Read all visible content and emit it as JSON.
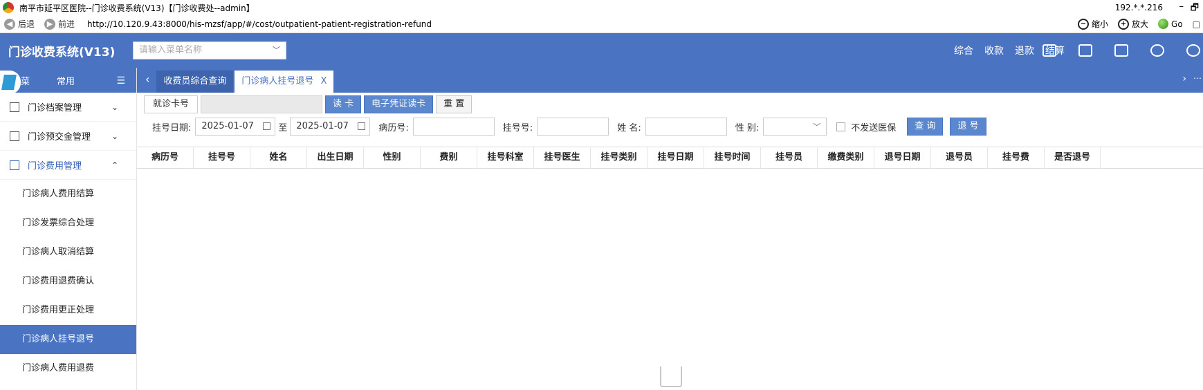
{
  "window": {
    "title": "南平市延平区医院--门诊收费系统(V13)【门诊收费处--admin】",
    "ip": "192.*.*.216",
    "minimize": "–",
    "restore": "🗗"
  },
  "browser": {
    "back": "后退",
    "forward": "前进",
    "url": "http://10.120.9.43:8000/his-mzsf/app/#/cost/outpatient-patient-registration-refund",
    "zoom_out": "缩小",
    "zoom_in": "放大",
    "go": "Go",
    "extra": "□"
  },
  "header": {
    "app_title": "门诊收费系统(V13)",
    "menu_search_placeholder": "请输入菜单名称",
    "links": [
      "综合",
      "收款",
      "退款",
      "结算"
    ]
  },
  "sidebar": {
    "top_partial": "菜",
    "favorites": "常用",
    "groups": [
      {
        "label": "门诊档案管理",
        "arrow": "⌄"
      },
      {
        "label": "门诊预交金管理",
        "arrow": "⌄"
      },
      {
        "label": "门诊费用管理",
        "arrow": "⌃"
      }
    ],
    "sub_items": [
      "门诊病人费用结算",
      "门诊发票综合处理",
      "门诊病人取消结算",
      "门诊费用退费确认",
      "门诊费用更正处理",
      "门诊病人挂号退号",
      "门诊病人费用退费"
    ]
  },
  "tabs": [
    {
      "label": "收费员综合查询"
    },
    {
      "label": "门诊病人挂号退号",
      "close": "X"
    }
  ],
  "form": {
    "card_label": "就诊卡号",
    "read_card": "读 卡",
    "e_card": "电子凭证读卡",
    "reset": "重 置",
    "reg_date_label": "挂号日期:",
    "date_from": "2025-01-07",
    "to": "至",
    "date_to": "2025-01-07",
    "record_label": "病历号:",
    "reg_no_label": "挂号号:",
    "name_label": "姓 名:",
    "gender_label": "性 别:",
    "no_insurance": "不发送医保",
    "query": "查 询",
    "refund": "退 号"
  },
  "table": {
    "columns": [
      "病历号",
      "挂号号",
      "姓名",
      "出生日期",
      "性别",
      "费别",
      "挂号科室",
      "挂号医生",
      "挂号类别",
      "挂号日期",
      "挂号时间",
      "挂号员",
      "缴费类别",
      "退号日期",
      "退号员",
      "挂号费",
      "是否退号"
    ]
  },
  "colors": {
    "primary": "#4a74c2",
    "active_item": "#4a74c2"
  }
}
